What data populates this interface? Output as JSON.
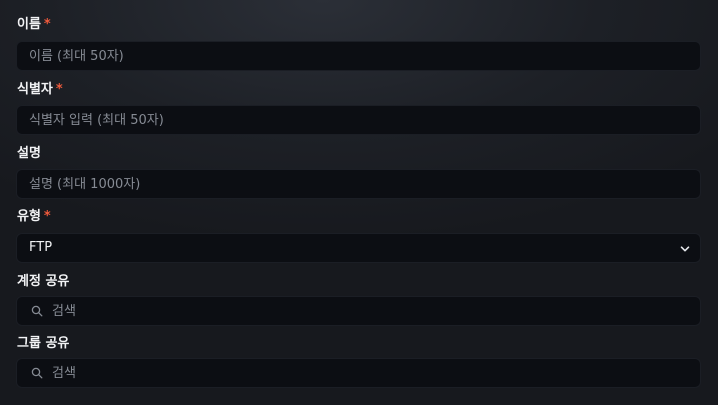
{
  "form": {
    "name": {
      "label": "이름",
      "required": "*",
      "placeholder": "이름 (최대 50자)"
    },
    "identifier": {
      "label": "식별자",
      "required": "*",
      "placeholder": "식별자 입력 (최대 50자)"
    },
    "description": {
      "label": "설명",
      "placeholder": "설명 (최대 1000자)"
    },
    "type": {
      "label": "유형",
      "required": "*",
      "value": "FTP"
    },
    "account_share": {
      "label": "계정 공유",
      "placeholder": "검색"
    },
    "group_share": {
      "label": "그룹 공유",
      "placeholder": "검색"
    }
  },
  "colors": {
    "required": "#ef5a3c",
    "field_bg": "#0c0e13",
    "page_bg": "#1d2026"
  },
  "icons": {
    "search": "search-icon",
    "dropdown": "chevron-down-icon"
  }
}
